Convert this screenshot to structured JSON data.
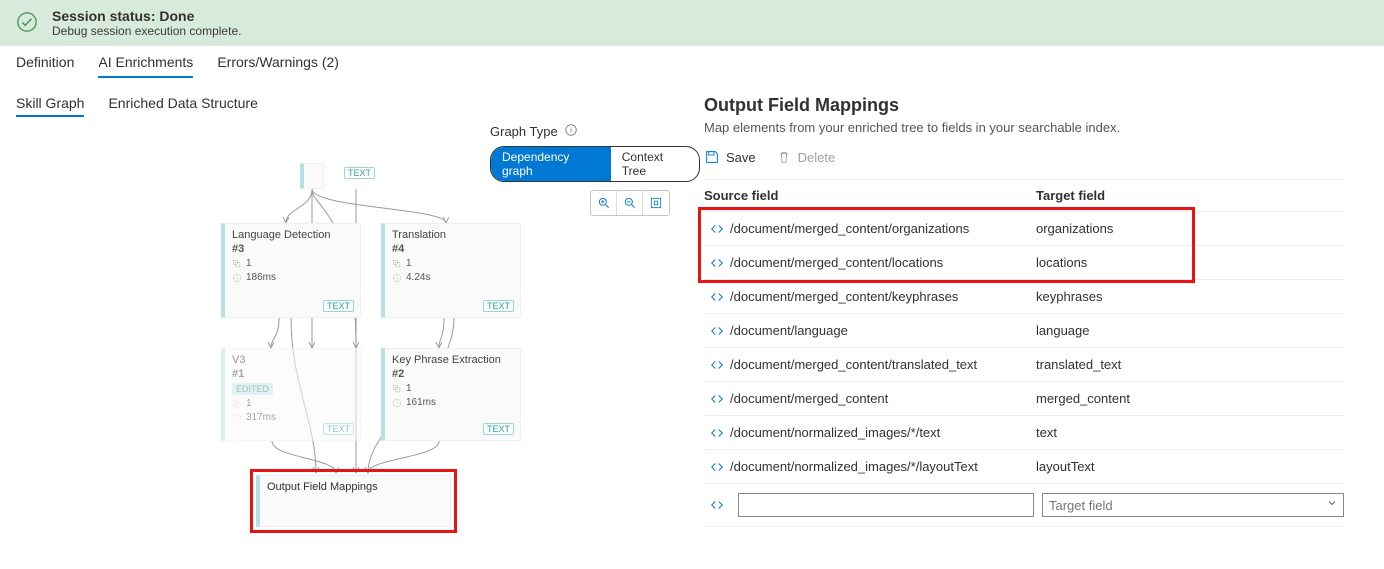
{
  "banner": {
    "title": "Session status: Done",
    "subtitle": "Debug session execution complete."
  },
  "tabs_top": [
    {
      "label": "Definition"
    },
    {
      "label": "AI Enrichments",
      "active": true
    },
    {
      "label": "Errors/Warnings (2)"
    }
  ],
  "tabs_sub": [
    {
      "label": "Skill Graph",
      "active": true
    },
    {
      "label": "Enriched Data Structure"
    }
  ],
  "graph": {
    "label": "Graph Type",
    "options": {
      "a": "Dependency graph",
      "b": "Context Tree"
    },
    "cards": {
      "lang": {
        "title": "Language Detection",
        "id": "#3",
        "count": "1",
        "time": "186ms"
      },
      "tran": {
        "title": "Translation",
        "id": "#4",
        "count": "1",
        "time": "4.24s"
      },
      "kpe": {
        "title": "Key Phrase Extraction",
        "id": "#2",
        "count": "1",
        "time": "161ms"
      },
      "v3": {
        "title": "V3",
        "id": "#1",
        "count": "1",
        "time": "317ms",
        "badge": "EDITED"
      }
    },
    "text_badge": "TEXT",
    "ofm": "Output Field Mappings"
  },
  "panel": {
    "title": "Output Field Mappings",
    "subtitle": "Map elements from your enriched tree to fields in your searchable index.",
    "toolbar": {
      "save": "Save",
      "delete": "Delete"
    },
    "th": {
      "source": "Source field",
      "target": "Target field"
    },
    "rows": [
      {
        "sf": "/document/merged_content/organizations",
        "tf": "organizations"
      },
      {
        "sf": "/document/merged_content/locations",
        "tf": "locations"
      },
      {
        "sf": "/document/merged_content/keyphrases",
        "tf": "keyphrases"
      },
      {
        "sf": "/document/language",
        "tf": "language"
      },
      {
        "sf": "/document/merged_content/translated_text",
        "tf": "translated_text"
      },
      {
        "sf": "/document/merged_content",
        "tf": "merged_content"
      },
      {
        "sf": "/document/normalized_images/*/text",
        "tf": "text"
      },
      {
        "sf": "/document/normalized_images/*/layoutText",
        "tf": "layoutText"
      }
    ],
    "new_placeholder": {
      "target": "Target field"
    }
  }
}
